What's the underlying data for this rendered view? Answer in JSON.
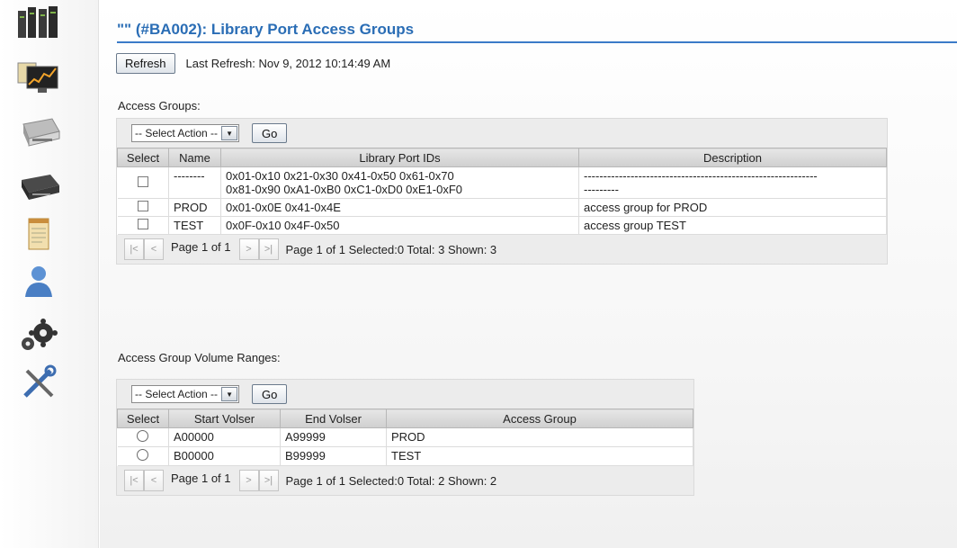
{
  "sidebar": {
    "icons": [
      {
        "name": "libraries-icon"
      },
      {
        "name": "monitor-icon"
      },
      {
        "name": "appliance-icon"
      },
      {
        "name": "drive-icon"
      },
      {
        "name": "notepad-icon"
      },
      {
        "name": "user-icon"
      },
      {
        "name": "settings-gears-icon"
      },
      {
        "name": "tools-icon"
      }
    ]
  },
  "header": {
    "title": "\"\" (#BA002): Library Port Access Groups"
  },
  "refresh": {
    "button_label": "Refresh",
    "last_refresh": "Last Refresh:  Nov 9, 2012 10:14:49 AM"
  },
  "access_groups": {
    "label": "Access Groups:",
    "select_action": "-- Select Action --",
    "go_label": "Go",
    "columns": [
      "Select",
      "Name",
      "Library Port IDs",
      "Description"
    ],
    "rows": [
      {
        "name": "--------",
        "port_ids_1": "0x01-0x10 0x21-0x30 0x41-0x50 0x61-0x70",
        "port_ids_2": "0x81-0x90 0xA1-0xB0 0xC1-0xD0 0xE1-0xF0",
        "desc_1": "------------------------------------------------------------",
        "desc_2": "---------"
      },
      {
        "name": "PROD",
        "port_ids_1": "0x01-0x0E 0x41-0x4E",
        "port_ids_2": "",
        "desc_1": "access group for PROD",
        "desc_2": ""
      },
      {
        "name": "TEST",
        "port_ids_1": "0x0F-0x10 0x4F-0x50",
        "port_ids_2": "",
        "desc_1": "access group TEST",
        "desc_2": ""
      }
    ],
    "pager": {
      "page_label": "Page 1 of 1",
      "summary": "Page 1 of 1 Selected:0 Total: 3 Shown: 3"
    }
  },
  "volume_ranges": {
    "label": "Access Group Volume Ranges:",
    "select_action": "-- Select Action --",
    "go_label": "Go",
    "columns": [
      "Select",
      "Start Volser",
      "End Volser",
      "Access Group"
    ],
    "rows": [
      {
        "start": "A00000",
        "end": "A99999",
        "group": "PROD"
      },
      {
        "start": "B00000",
        "end": "B99999",
        "group": "TEST"
      }
    ],
    "pager": {
      "page_label": "Page 1 of 1",
      "summary": "Page 1 of 1 Selected:0 Total: 2 Shown: 2"
    }
  },
  "pager_icons": [
    "first-page-icon",
    "previous-page-icon",
    "next-page-icon",
    "last-page-icon"
  ],
  "colors": {
    "title": "#2a6db5",
    "title_rule": "#3b7bc8",
    "header_bg": "#d6d6d6"
  }
}
